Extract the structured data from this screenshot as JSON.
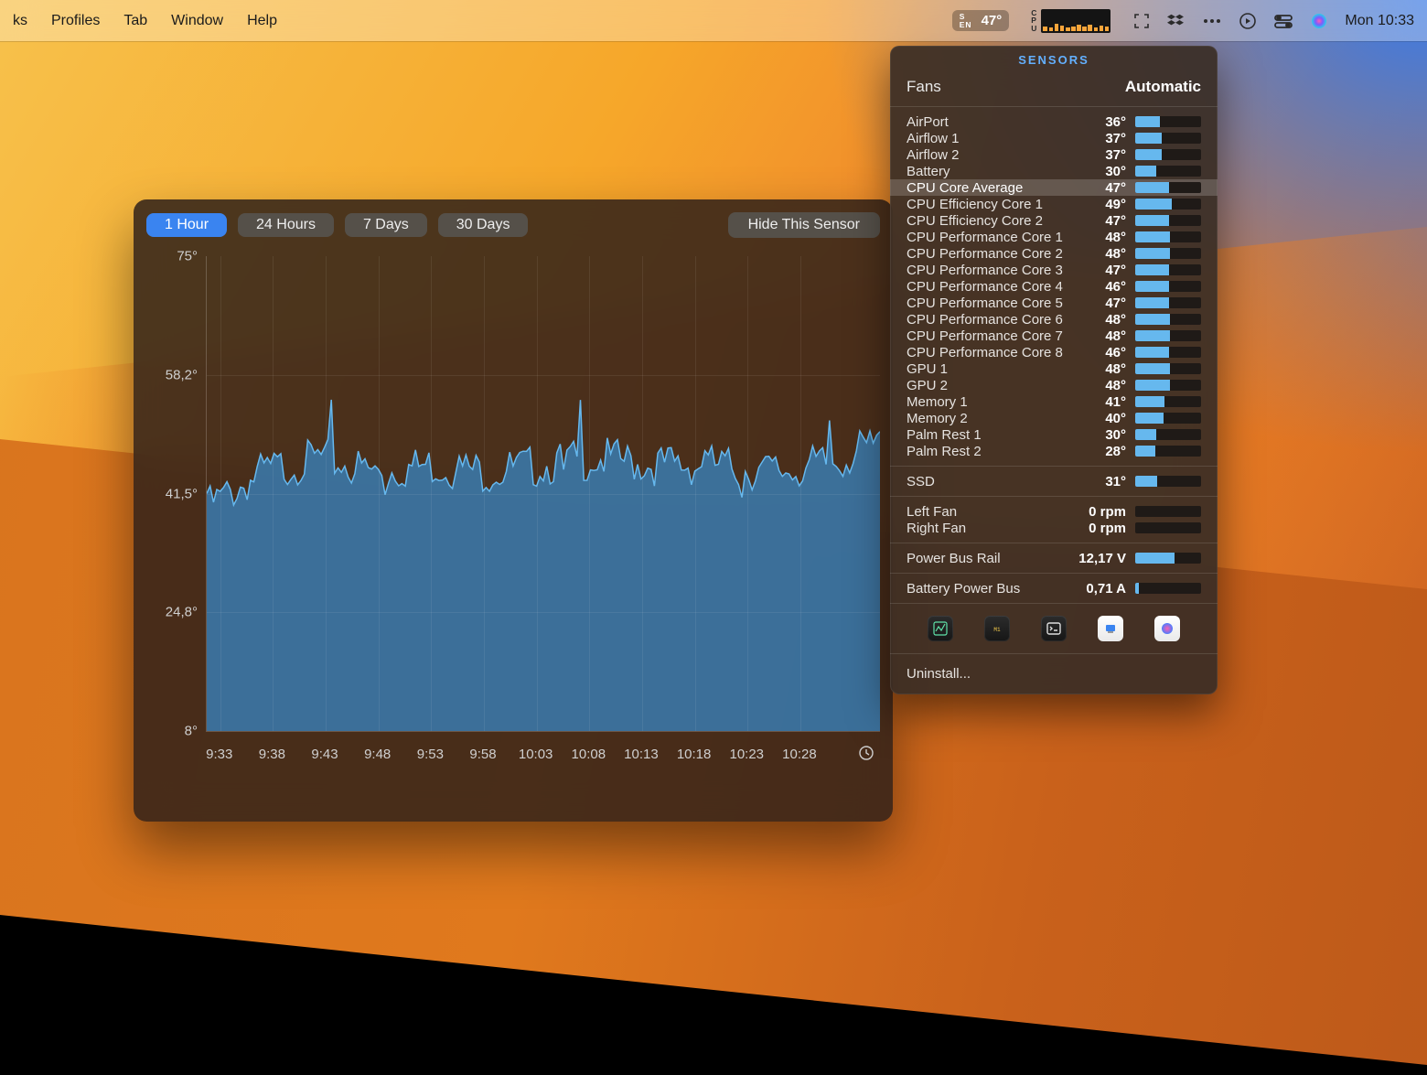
{
  "menubar": {
    "left_items": [
      "ks",
      "Profiles",
      "Tab",
      "Window",
      "Help"
    ],
    "sen_tag_top": "S",
    "sen_tag_bot": "EN",
    "sen_value": "47°",
    "cpu_tag_top": "C",
    "cpu_tag_mid": "P",
    "cpu_tag_bot": "U",
    "clock": "Mon 10:33"
  },
  "popover": {
    "title": "SENSORS",
    "fans_label": "Fans",
    "fans_mode": "Automatic",
    "sensors": [
      {
        "label": "AirPort",
        "value": "36°",
        "pct": 38
      },
      {
        "label": "Airflow 1",
        "value": "37°",
        "pct": 40
      },
      {
        "label": "Airflow 2",
        "value": "37°",
        "pct": 40
      },
      {
        "label": "Battery",
        "value": "30°",
        "pct": 32
      },
      {
        "label": "CPU Core Average",
        "value": "47°",
        "pct": 52,
        "selected": true
      },
      {
        "label": "CPU Efficiency Core 1",
        "value": "49°",
        "pct": 55
      },
      {
        "label": "CPU Efficiency Core 2",
        "value": "47°",
        "pct": 52
      },
      {
        "label": "CPU Performance Core 1",
        "value": "48°",
        "pct": 53
      },
      {
        "label": "CPU Performance Core 2",
        "value": "48°",
        "pct": 53
      },
      {
        "label": "CPU Performance Core 3",
        "value": "47°",
        "pct": 52
      },
      {
        "label": "CPU Performance Core 4",
        "value": "46°",
        "pct": 51
      },
      {
        "label": "CPU Performance Core 5",
        "value": "47°",
        "pct": 52
      },
      {
        "label": "CPU Performance Core 6",
        "value": "48°",
        "pct": 53
      },
      {
        "label": "CPU Performance Core 7",
        "value": "48°",
        "pct": 53
      },
      {
        "label": "CPU Performance Core 8",
        "value": "46°",
        "pct": 51
      },
      {
        "label": "GPU 1",
        "value": "48°",
        "pct": 53
      },
      {
        "label": "GPU 2",
        "value": "48°",
        "pct": 53
      },
      {
        "label": "Memory 1",
        "value": "41°",
        "pct": 44
      },
      {
        "label": "Memory 2",
        "value": "40°",
        "pct": 43
      },
      {
        "label": "Palm Rest 1",
        "value": "30°",
        "pct": 32
      },
      {
        "label": "Palm Rest 2",
        "value": "28°",
        "pct": 30
      }
    ],
    "ssd": {
      "label": "SSD",
      "value": "31°",
      "pct": 33
    },
    "left_fan": {
      "label": "Left Fan",
      "value": "0 rpm",
      "pct": 0
    },
    "right_fan": {
      "label": "Right Fan",
      "value": "0 rpm",
      "pct": 0
    },
    "power_bus": {
      "label": "Power Bus Rail",
      "value": "12,17 V",
      "pct": 60
    },
    "batt_bus": {
      "label": "Battery Power Bus",
      "value": "0,71 A",
      "pct": 5
    },
    "uninstall": "Uninstall..."
  },
  "chart": {
    "ranges": [
      "1 Hour",
      "24 Hours",
      "7 Days",
      "30 Days"
    ],
    "active_range_index": 0,
    "hide_label": "Hide This Sensor"
  },
  "chart_data": {
    "type": "area",
    "title": "CPU Core Average",
    "xlabel": "",
    "ylabel": "",
    "ylim": [
      8,
      75
    ],
    "y_ticks": [
      "75°",
      "58,2°",
      "41,5°",
      "24,8°",
      "8°"
    ],
    "x_ticks": [
      "9:33",
      "9:38",
      "9:43",
      "9:48",
      "9:53",
      "9:58",
      "10:03",
      "10:08",
      "10:13",
      "10:18",
      "10:23",
      "10:28"
    ],
    "series": [
      {
        "name": "CPU Core Average (°C)",
        "x": [
          "9:33",
          "9:38",
          "9:43",
          "9:48",
          "9:53",
          "9:58",
          "10:03",
          "10:08",
          "10:13",
          "10:18",
          "10:23",
          "10:28",
          "10:33"
        ],
        "values": [
          41,
          46,
          48,
          46,
          47,
          46,
          47,
          48,
          47,
          47,
          46,
          47,
          50
        ]
      }
    ]
  }
}
